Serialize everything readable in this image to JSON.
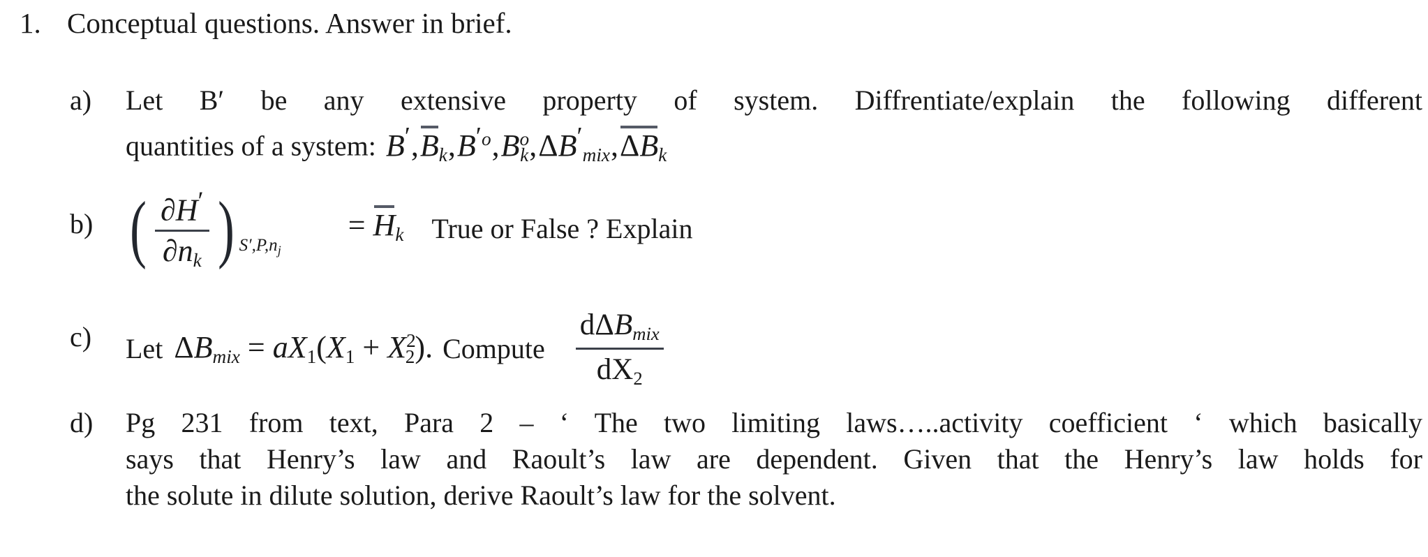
{
  "document": {
    "question_number": "1.",
    "question_title": "Conceptual questions. Answer in brief."
  },
  "items": {
    "a": {
      "marker": "a)",
      "line1": "Let  B′  be  any  extensive  property  of  system.  Diffrentiate/explain  the  following  different",
      "line2_prefix": "quantities of a system:",
      "math": {
        "t1_var": "B",
        "t1_prime": "′",
        "t2_var": "B",
        "t2_sub": "k",
        "t3_var": "B",
        "t3_prime": "′",
        "t3_sup": "o",
        "t4_var": "B",
        "t4_sub": "k",
        "t4_sup": "o",
        "t5_delta": "Δ",
        "t5_var": "B",
        "t5_prime": "′",
        "t5_sub": "mix",
        "t6_delta": "Δ",
        "t6_var": "B",
        "t6_sub": "k",
        "comma": ","
      }
    },
    "b": {
      "marker": "b)",
      "numerator_partial": "∂",
      "numerator_var": "H",
      "numerator_prime": "′",
      "denominator_partial": "∂",
      "denominator_var": "n",
      "denominator_sub": "k",
      "paren_left": "(",
      "paren_right": ")",
      "paren_subscript": "S′,P,n",
      "paren_subscript_tail": "j",
      "equals": "=",
      "rhs_var": "H",
      "rhs_sub": "k",
      "question": "True or False ? Explain"
    },
    "c": {
      "marker": "c)",
      "let": "Let",
      "lhs_delta": "Δ",
      "lhs_var": "B",
      "lhs_sub": "mix",
      "equals": "=",
      "rhs_a": "a",
      "rhs_X1": "X",
      "rhs_X1_sub": "1",
      "rhs_open": "(",
      "rhs_X1b": "X",
      "rhs_X1b_sub": "1",
      "rhs_plus": "+",
      "rhs_X2": "X",
      "rhs_X2_sub": "2",
      "rhs_X2_sup": "2",
      "rhs_close": ")",
      "period": ".",
      "compute": "Compute",
      "frac_num_d": "d",
      "frac_num_delta": "Δ",
      "frac_num_var": "B",
      "frac_num_sub": "mix",
      "frac_den_d": "d",
      "frac_den_var": "X",
      "frac_den_sub": "2"
    },
    "d": {
      "marker": "d)",
      "line1": "Pg 231 from text, Para 2 – ‘ The two limiting laws…..activity coefficient ‘ which basically",
      "line2": "says that Henry’s law and Raoult’s law are dependent. Given that the Henry’s law holds for",
      "line3": "the solute in dilute solution, derive Raoult’s law for the solvent."
    }
  },
  "colors": {
    "text": "#1a1a1a",
    "rule": "#3b4049",
    "overline": "#555a66",
    "background": "#ffffff"
  }
}
